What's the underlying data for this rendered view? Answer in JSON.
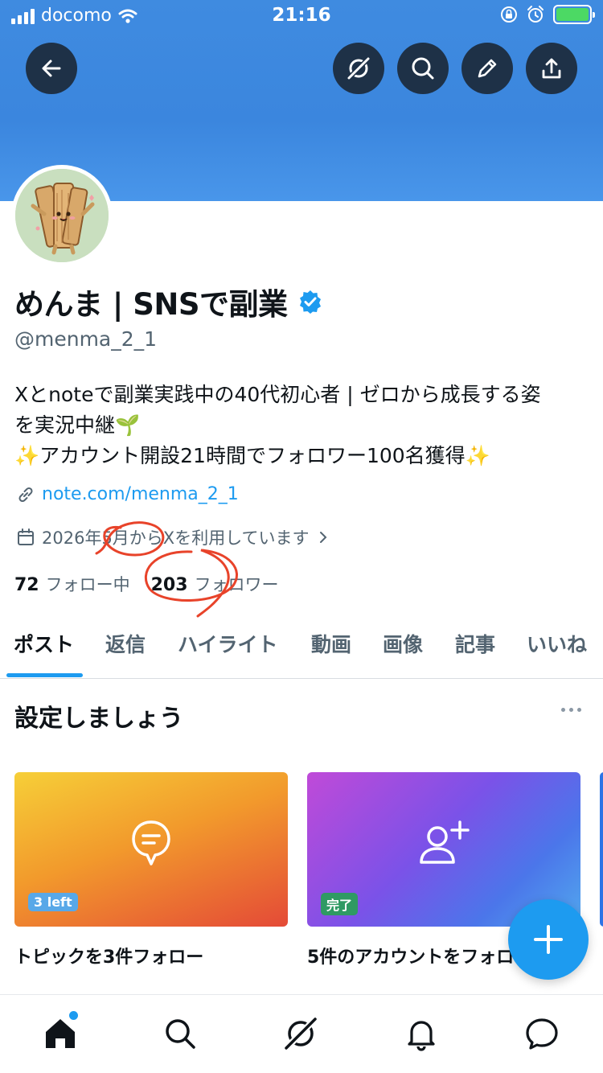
{
  "status_bar": {
    "carrier": "docomo",
    "time": "21:16"
  },
  "header": {
    "buttons": [
      {
        "name": "back-button",
        "icon": "arrow-left-icon"
      },
      {
        "name": "grok-button",
        "icon": "grok-icon"
      },
      {
        "name": "search-button",
        "icon": "search-icon"
      },
      {
        "name": "edit-button",
        "icon": "pencil-icon"
      },
      {
        "name": "share-button",
        "icon": "share-icon"
      }
    ]
  },
  "profile": {
    "display_name": "めんま | SNSで副業",
    "verified": true,
    "handle": "@menma_2_1",
    "bio_lines": [
      "Xとnoteで副業実践中の40代初心者 | ゼロから成長する姿",
      "を実況中継🌱",
      "✨アカウント開設21時間でフォロワー100名獲得✨"
    ],
    "link": "note.com/menma_2_1",
    "joined": "2026年5月からXを利用しています",
    "following_count": "72",
    "following_label": "フォロー中",
    "followers_count": "203",
    "followers_label": "フォロワー"
  },
  "tabs": [
    "ポスト",
    "返信",
    "ハイライト",
    "動画",
    "画像",
    "記事",
    "いいね"
  ],
  "active_tab": "ポスト",
  "setup": {
    "title": "設定しましょう",
    "cards": [
      {
        "badge": "3 left",
        "caption": "トピックを3件フォロー",
        "icon": "topic-bubble-icon"
      },
      {
        "badge": "完了",
        "caption": "5件のアカウントをフォロー",
        "icon": "add-user-icon"
      }
    ]
  },
  "bottom_nav": [
    "home-icon",
    "search-icon",
    "grok-icon",
    "bell-icon",
    "messages-icon"
  ],
  "colors": {
    "accent": "#1d9bf0",
    "banner": "#3b86de",
    "annotation": "#e8432a"
  }
}
